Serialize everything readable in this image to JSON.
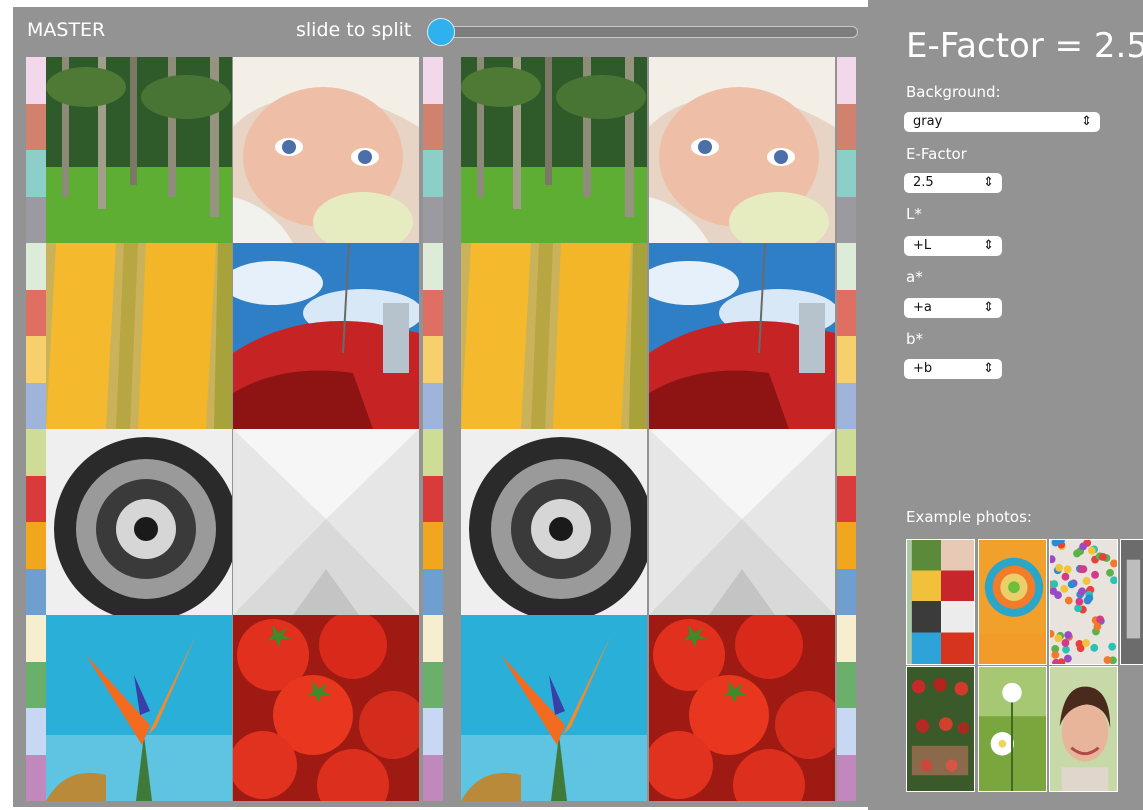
{
  "viewer": {
    "master_label": "MASTER",
    "split_label": "slide to split",
    "slider_value": 0
  },
  "panel": {
    "title": "E-Factor = 2.5",
    "background_label": "Background:",
    "background_value": "gray",
    "efactor_label": "E-Factor",
    "efactor_value": "2.5",
    "l_label": "L*",
    "l_value": "+L",
    "a_label": "a*",
    "a_value": "+a",
    "b_label": "b*",
    "b_value": "+b",
    "examples_label": "Example photos:"
  },
  "patch_colors": {
    "left": [
      [
        "#f2d8ea",
        "#d0826e",
        "#8ccfc9",
        "#9a9aa0"
      ],
      [
        "#dcecd9",
        "#e06f63",
        "#f7cf6c",
        "#9eb4d8"
      ],
      [
        "#cfdc95",
        "#d93a3a",
        "#f0a71e",
        "#6f9fd1"
      ],
      [
        "#f6efcf",
        "#6ab06b",
        "#c8d7f2",
        "#c088bd"
      ]
    ],
    "right": [
      [
        "#f2d8ea",
        "#d0826e",
        "#8ccfc9",
        "#9a9aa0"
      ],
      [
        "#dcecd9",
        "#e06f63",
        "#f7cf6c",
        "#9eb4d8"
      ],
      [
        "#cfdc95",
        "#d93a3a",
        "#f0a71e",
        "#6f9fd1"
      ],
      [
        "#f6efcf",
        "#6ab06b",
        "#c8d7f2",
        "#c088bd"
      ]
    ]
  },
  "photos": [
    "palm-trees",
    "baby",
    "corn",
    "red-truck",
    "spiral-staircase",
    "white-paper",
    "bird-of-paradise",
    "tomatoes"
  ],
  "example_photos": [
    "grid-sample",
    "orange-spiral",
    "confetti-dots",
    "bw-portrait",
    "produce-market",
    "white-flower",
    "smiling-woman"
  ]
}
